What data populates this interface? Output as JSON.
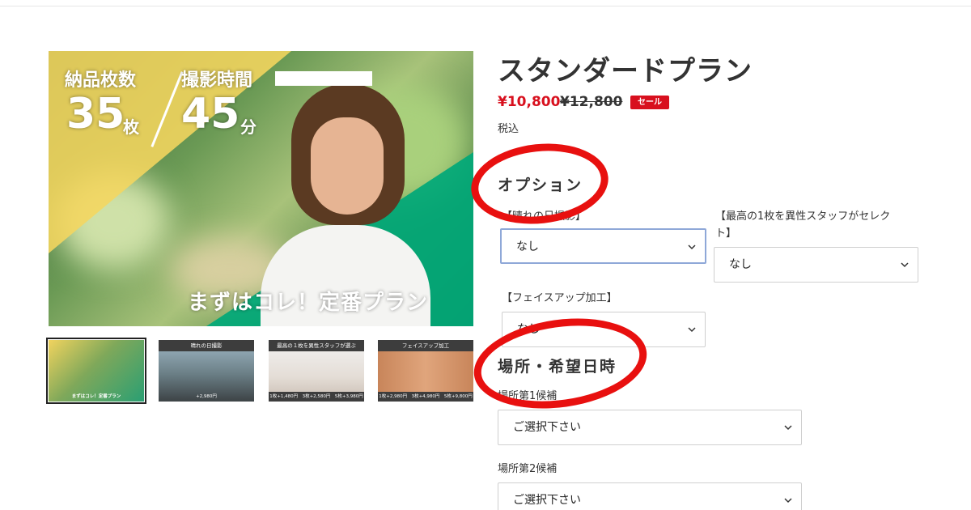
{
  "hero": {
    "delivery_label": "納品枚数",
    "delivery_count": "35",
    "delivery_unit": "枚",
    "time_label": "撮影時間",
    "time_count": "45",
    "time_unit": "分",
    "tagline": "まずはコレ！定番プラン"
  },
  "thumbnails": [
    {
      "title": "",
      "price": "まずはコレ！定番プラン"
    },
    {
      "title": "晴れの日撮影",
      "price": "+2,980円"
    },
    {
      "title": "最高の１枚を異性スタッフが選ぶ",
      "price": "1枚+1,480円　3枚+2,580円　5枚+3,980円"
    },
    {
      "title": "フェイスアップ加工",
      "price": "1枚+2,980円　3枚+4,980円　5枚+9,800円"
    }
  ],
  "product": {
    "title": "スタンダードプラン",
    "sale_price": "¥10,800",
    "original_price": "¥12,800",
    "sale_badge": "セール",
    "tax_note": "税込"
  },
  "options": {
    "heading": "オプション",
    "sunny": {
      "label": "【晴れの日撮影】",
      "value": "なし"
    },
    "staff": {
      "label_line1": "【最高の1枚を異性スタッフがセレク",
      "label_line2": "ト】",
      "value": "なし"
    },
    "face": {
      "label": "【フェイスアップ加工】",
      "value": "なし"
    }
  },
  "place": {
    "heading": "場所・希望日時",
    "first": {
      "label": "場所第1候補",
      "value": "ご選択下さい"
    },
    "second": {
      "label": "場所第2候補",
      "value": "ご選択下さい"
    }
  },
  "colors": {
    "accent_red": "#e8100f",
    "sale_red": "#d8101e",
    "focus_blue": "#8fa8d8"
  }
}
